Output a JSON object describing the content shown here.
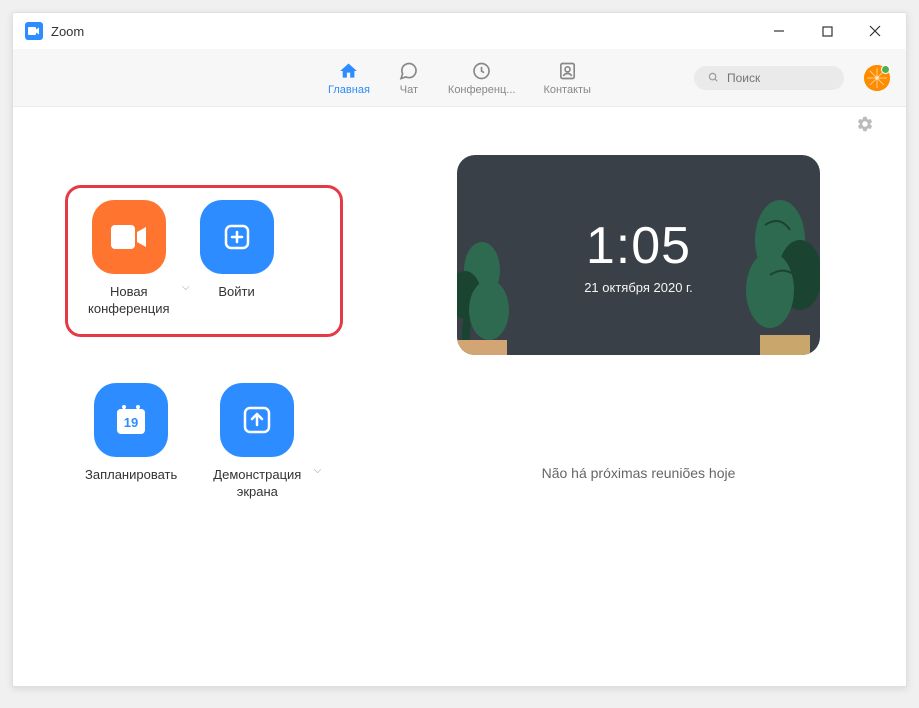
{
  "app": {
    "title": "Zoom"
  },
  "tabs": {
    "home": "Главная",
    "chat": "Чат",
    "meetings": "Конференц...",
    "contacts": "Контакты"
  },
  "search": {
    "placeholder": "Поиск"
  },
  "actions": {
    "new_meeting": "Новая\nконференция",
    "join": "Войти",
    "schedule": "Запланировать",
    "schedule_day": "19",
    "share_screen": "Демонстрация\nэкрана"
  },
  "clock": {
    "time": "1:05",
    "date": "21 октября 2020 г."
  },
  "status": {
    "no_meetings": "Não há próximas reuniões hoje"
  }
}
